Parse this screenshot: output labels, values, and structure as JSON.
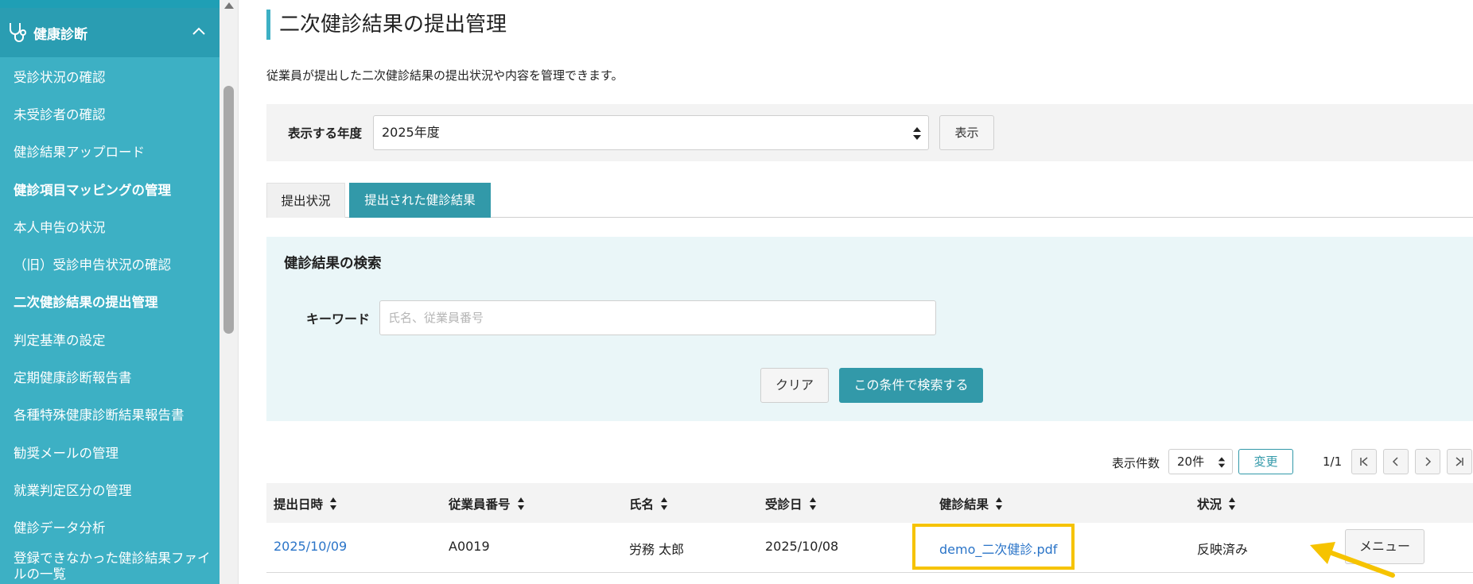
{
  "sidebar": {
    "header": {
      "label": "健康診断",
      "icon": "stethoscope-icon"
    },
    "items": [
      {
        "label": "受診状況の確認",
        "bold": false
      },
      {
        "label": "未受診者の確認",
        "bold": false
      },
      {
        "label": "健診結果アップロード",
        "bold": false
      },
      {
        "label": "健診項目マッピングの管理",
        "bold": true
      },
      {
        "label": "本人申告の状況",
        "bold": false
      },
      {
        "label": "（旧）受診申告状況の確認",
        "bold": false
      },
      {
        "label": "二次健診結果の提出管理",
        "bold": true
      },
      {
        "label": "判定基準の設定",
        "bold": false
      },
      {
        "label": "定期健康診断報告書",
        "bold": false
      },
      {
        "label": "各種特殊健康診断結果報告書",
        "bold": false
      },
      {
        "label": "勧奨メールの管理",
        "bold": false
      },
      {
        "label": "就業判定区分の管理",
        "bold": false
      },
      {
        "label": "健診データ分析",
        "bold": false
      },
      {
        "label": "登録できなかった健診結果ファイルの一覧",
        "bold": false
      }
    ]
  },
  "main": {
    "title": "二次健診結果の提出管理",
    "description": "従業員が提出した二次健診結果の提出状況や内容を管理できます。",
    "year": {
      "label": "表示する年度",
      "selected": "2025年度",
      "show_button": "表示"
    },
    "tabs": [
      {
        "label": "提出状況",
        "active": false
      },
      {
        "label": "提出された健診結果",
        "active": true
      }
    ],
    "search": {
      "title": "健診結果の検索",
      "keyword_label": "キーワード",
      "keyword_value": "",
      "keyword_placeholder": "氏名、従業員番号",
      "clear_button": "クリア",
      "search_button": "この条件で検索する"
    },
    "pager": {
      "per_page_label": "表示件数",
      "per_page_selected": "20件",
      "change_button": "変更",
      "page_info": "1/1"
    },
    "table": {
      "columns": [
        "提出日時",
        "従業員番号",
        "氏名",
        "受診日",
        "健診結果",
        "状況"
      ],
      "rows": [
        {
          "submitted": "2025/10/09",
          "employee_no": "A0019",
          "name": "労務 太郎",
          "exam_date": "2025/10/08",
          "result_file": "demo_二次健診.pdf",
          "status": "反映済み",
          "menu_button": "メニュー"
        }
      ]
    }
  },
  "colors": {
    "sidebar": "#3db0c4",
    "sidebar_header": "#2a9db2",
    "accent": "#3299a9",
    "link": "#2a74c8",
    "highlight": "#f6c300"
  }
}
